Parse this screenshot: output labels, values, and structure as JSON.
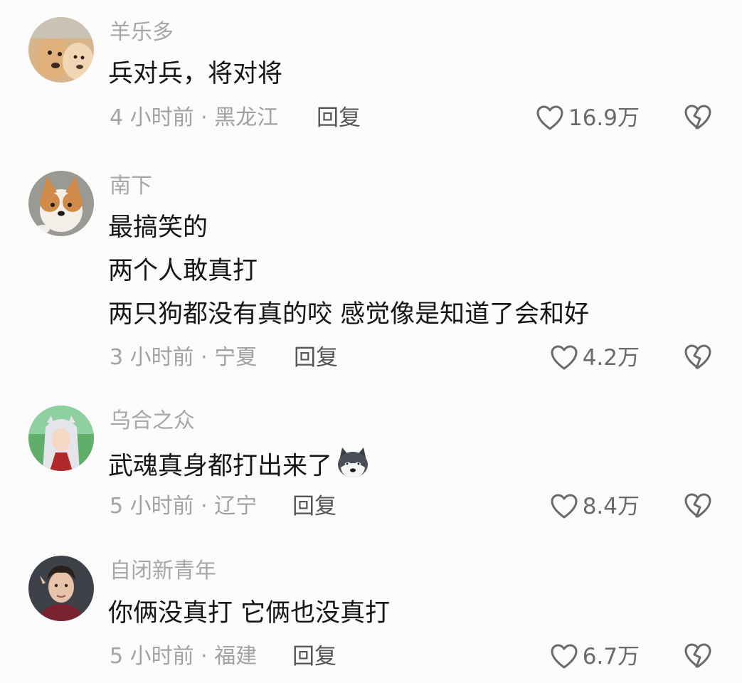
{
  "comments": [
    {
      "username": "羊乐多",
      "lines": [
        "兵对兵，将对将"
      ],
      "meta": "4 小时前 · 黑龙江",
      "reply_label": "回复",
      "likes": "16.9万",
      "avatar_icon": "dog-pair-avatar"
    },
    {
      "username": "南下",
      "lines": [
        "最搞笑的",
        "两个人敢真打",
        "两只狗都没有真的咬 感觉像是知道了会和好"
      ],
      "meta": "3 小时前 · 宁夏",
      "reply_label": "回复",
      "likes": "4.2万",
      "avatar_icon": "corgi-avatar"
    },
    {
      "username": "乌合之众",
      "lines": [
        "武魂真身都打出来了"
      ],
      "meta": "5 小时前 · 辽宁",
      "reply_label": "回复",
      "likes": "8.4万",
      "avatar_icon": "anime-character-avatar",
      "emoji_icon": "husky-dog-emoji"
    },
    {
      "username": "自闭新青年",
      "lines": [
        "你俩没真打 它俩也没真打"
      ],
      "meta": "5 小时前 · 福建",
      "reply_label": "回复",
      "likes": "6.7万",
      "avatar_icon": "person-avatar"
    }
  ],
  "icons": {
    "like": "heart-outline-icon",
    "dislike": "broken-heart-icon"
  },
  "colors": {
    "background": "#fbfbfb",
    "username": "#a7a7a7",
    "body_text": "#161616",
    "meta_text": "#a2a2a2",
    "reply_text": "#555555",
    "like_count": "#6a6a6a"
  }
}
